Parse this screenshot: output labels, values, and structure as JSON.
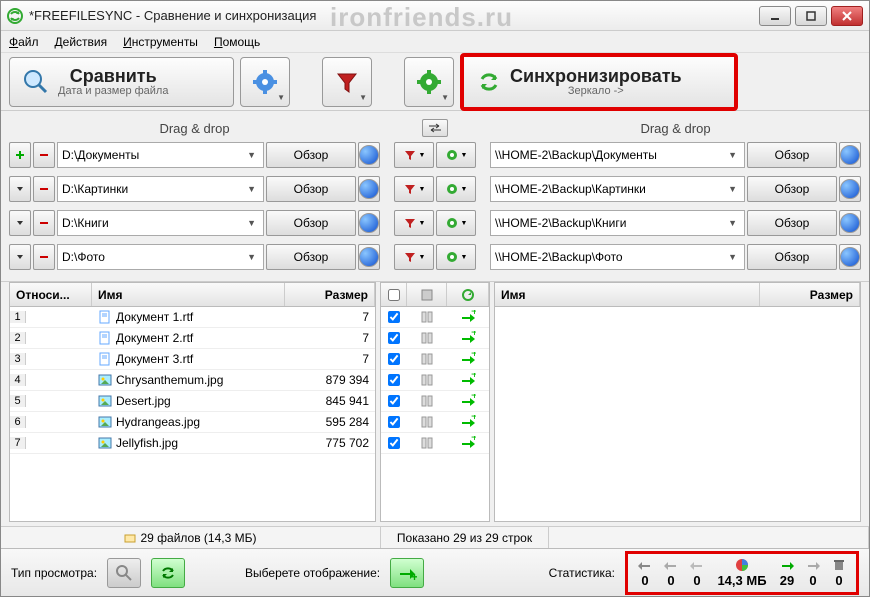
{
  "title": "*FREEFILESYNC - Сравнение и синхронизация",
  "watermark": "ironfriends.ru",
  "menu": [
    "Файл",
    "Действия",
    "Инструменты",
    "Помощь"
  ],
  "toolbar": {
    "compare": {
      "label": "Сравнить",
      "sub": "Дата и размер файла"
    },
    "sync": {
      "label": "Синхронизировать",
      "sub": "Зеркало ->"
    }
  },
  "drag_label": "Drag & drop",
  "browse_label": "Обзор",
  "pairs": {
    "left": [
      "D:\\Документы",
      "D:\\Картинки",
      "D:\\Книги",
      "D:\\Фото"
    ],
    "right": [
      "\\\\HOME-2\\Backup\\Документы",
      "\\\\HOME-2\\Backup\\Картинки",
      "\\\\HOME-2\\Backup\\Книги",
      "\\\\HOME-2\\Backup\\Фото"
    ]
  },
  "grid": {
    "headers": {
      "rel": "Относи...",
      "name": "Имя",
      "size": "Размер"
    },
    "rows": [
      {
        "n": "1",
        "name": "Документ 1.rtf",
        "size": "7",
        "type": "doc"
      },
      {
        "n": "2",
        "name": "Документ 2.rtf",
        "size": "7",
        "type": "doc"
      },
      {
        "n": "3",
        "name": "Документ 3.rtf",
        "size": "7",
        "type": "doc"
      },
      {
        "n": "4",
        "name": "Chrysanthemum.jpg",
        "size": "879 394",
        "type": "img"
      },
      {
        "n": "5",
        "name": "Desert.jpg",
        "size": "845 941",
        "type": "img"
      },
      {
        "n": "6",
        "name": "Hydrangeas.jpg",
        "size": "595 284",
        "type": "img"
      },
      {
        "n": "7",
        "name": "Jellyfish.jpg",
        "size": "775 702",
        "type": "img"
      }
    ],
    "status_left": "29 файлов (14,3 МБ)",
    "status_mid": "Показано 29 из 29 строк"
  },
  "bottom": {
    "view_label": "Тип просмотра:",
    "display_label": "Выберете отображение:",
    "stats_label": "Статистика:",
    "stats": [
      "0",
      "0",
      "0",
      "14,3 МБ",
      "29",
      "0",
      "0"
    ]
  }
}
